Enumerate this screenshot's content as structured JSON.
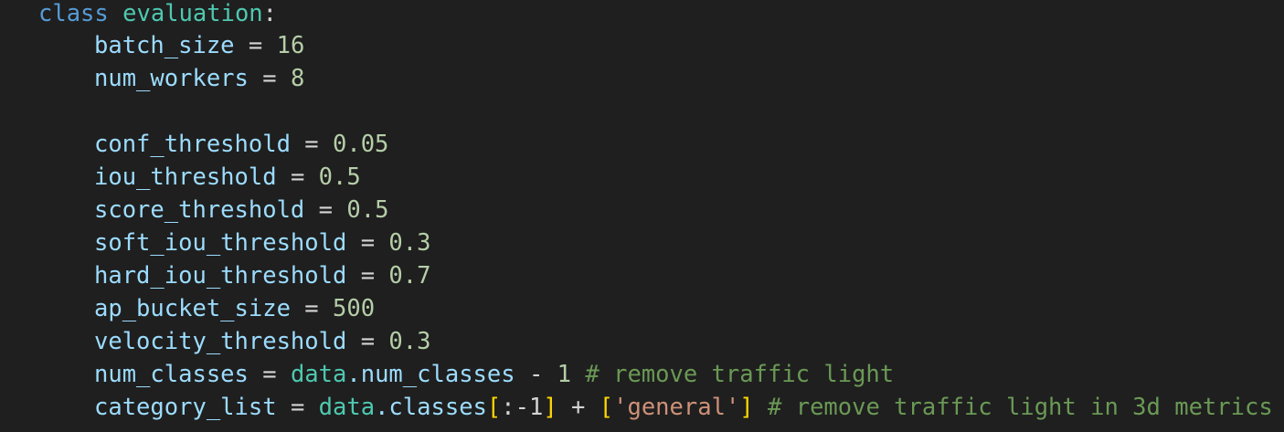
{
  "code": {
    "class_keyword": "class",
    "class_name": "evaluation",
    "colon": ":",
    "lines": [
      {
        "name": "batch_size",
        "op": " = ",
        "value": "16"
      },
      {
        "name": "num_workers",
        "op": " = ",
        "value": "8"
      },
      {
        "name": "conf_threshold",
        "op": " = ",
        "value": "0.05"
      },
      {
        "name": "iou_threshold",
        "op": " = ",
        "value": "0.5"
      },
      {
        "name": "score_threshold",
        "op": " = ",
        "value": "0.5"
      },
      {
        "name": "soft_iou_threshold",
        "op": " = ",
        "value": "0.3"
      },
      {
        "name": "hard_iou_threshold",
        "op": " = ",
        "value": "0.7"
      },
      {
        "name": "ap_bucket_size",
        "op": " = ",
        "value": "500"
      },
      {
        "name": "velocity_threshold",
        "op": " = ",
        "value": "0.3"
      }
    ],
    "num_classes_line": {
      "name": "num_classes",
      "op": " = ",
      "module": "data",
      "attr": ".num_classes",
      "minus": " - ",
      "value": "1",
      "comment": " # remove traffic light"
    },
    "category_list_line": {
      "name": "category_list",
      "op": " = ",
      "module": "data",
      "attr": ".classes",
      "open_bracket": "[",
      "slice": ":-1",
      "close_bracket": "]",
      "plus": " + ",
      "list_open": "[",
      "quote_open": "'",
      "string": "general",
      "quote_close": "'",
      "list_close": "]",
      "comment": " # remove traffic light in 3d metrics"
    }
  },
  "colors": {
    "background": "#1f1f1f",
    "keyword": "#569cd6",
    "class_name": "#4ec9b0",
    "variable": "#9cdcfe",
    "number": "#b5cea8",
    "string": "#ce9178",
    "comment": "#6a9955",
    "bracket_level1": "#ffd700",
    "bracket_level2": "#da70d6"
  }
}
